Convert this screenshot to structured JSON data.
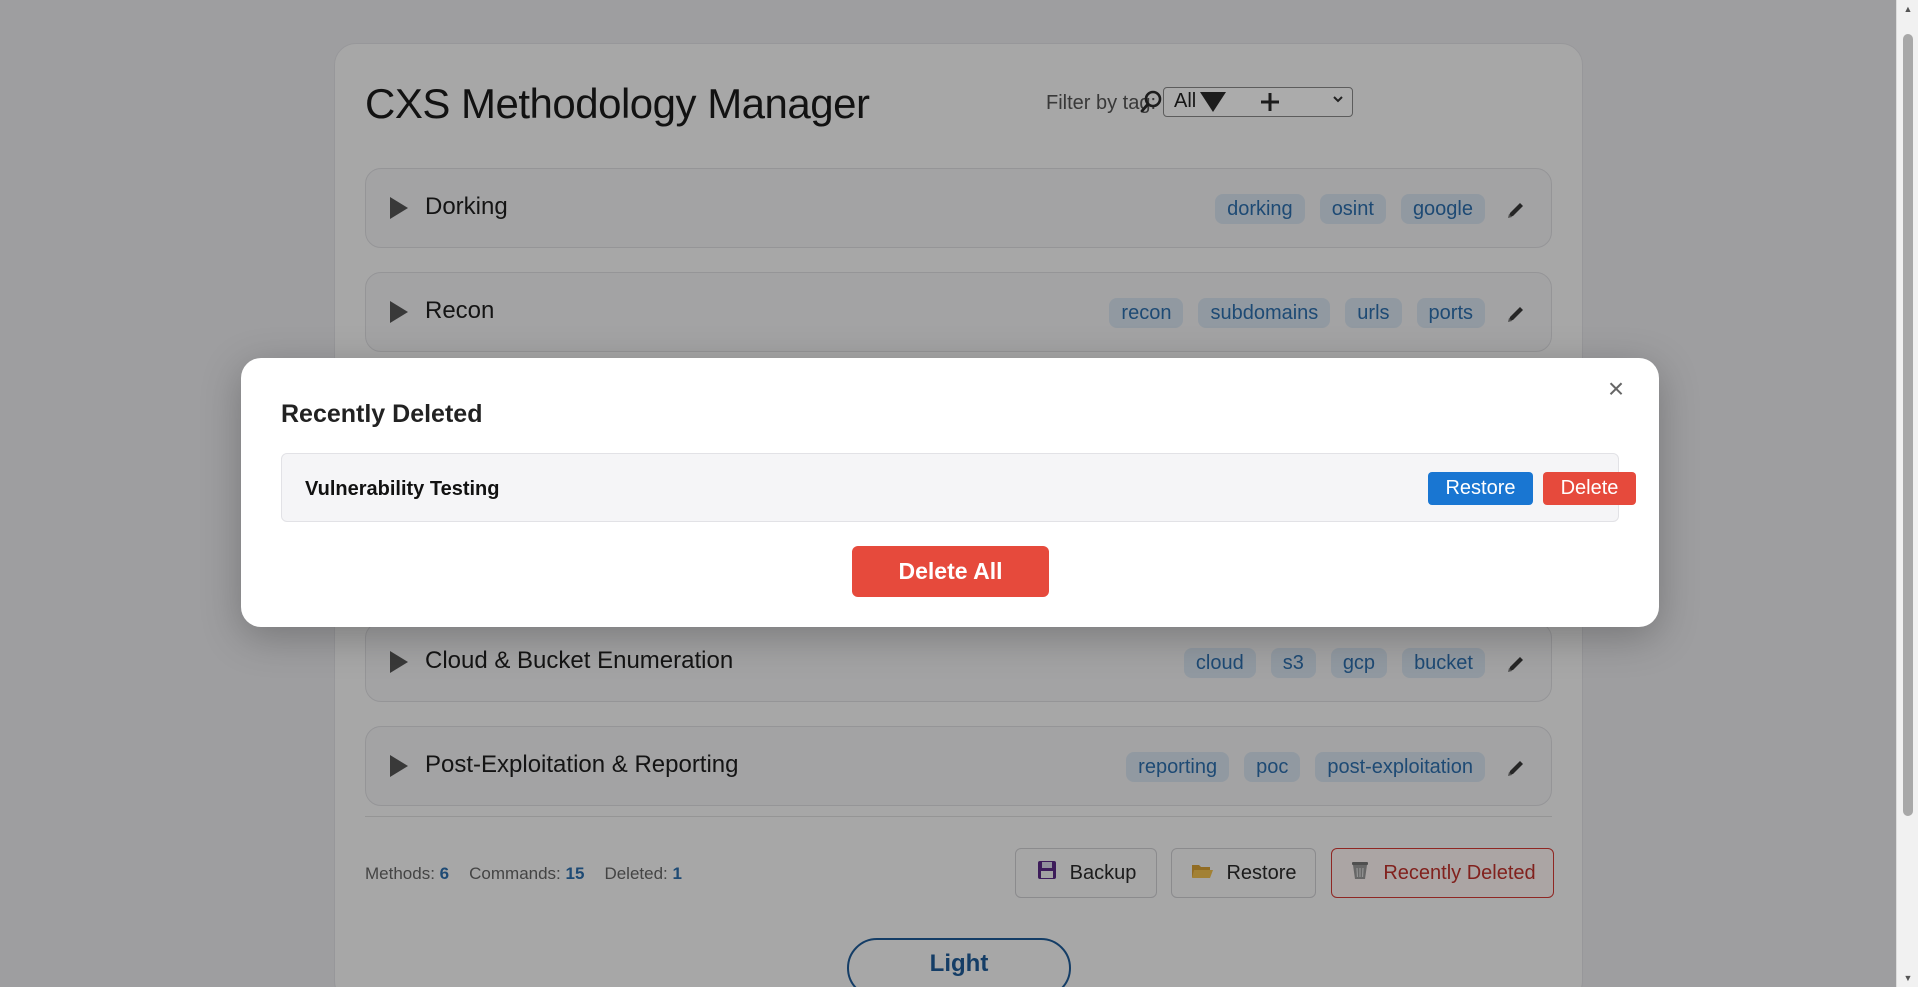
{
  "app": {
    "title": "CXS Methodology Manager",
    "filter_label": "Filter by tag:",
    "filter_value": "All"
  },
  "toolbar": {
    "search_icon": "search-icon",
    "filter_icon": "filter-icon",
    "add_icon": "plus-icon"
  },
  "methods": [
    {
      "name": "Dorking",
      "tags": [
        "dorking",
        "osint",
        "google"
      ]
    },
    {
      "name": "Recon",
      "tags": [
        "recon",
        "subdomains",
        "urls",
        "ports"
      ]
    },
    {
      "name": "Cloud & Bucket Enumeration",
      "tags": [
        "cloud",
        "s3",
        "gcp",
        "bucket"
      ]
    },
    {
      "name": "Post-Exploitation & Reporting",
      "tags": [
        "reporting",
        "poc",
        "post-exploitation"
      ]
    }
  ],
  "stats": {
    "methods_label": "Methods:",
    "methods_value": "6",
    "commands_label": "Commands:",
    "commands_value": "15",
    "deleted_label": "Deleted:",
    "deleted_value": "1"
  },
  "footer": {
    "backup_label": "Backup",
    "restore_label": "Restore",
    "recently_deleted_label": "Recently Deleted",
    "theme_label": "Light"
  },
  "modal": {
    "title": "Recently Deleted",
    "close_label": "×",
    "items": [
      {
        "name": "Vulnerability Testing",
        "restore_label": "Restore",
        "delete_label": "Delete"
      }
    ],
    "delete_all_label": "Delete All"
  },
  "colors": {
    "accent": "#1976d2",
    "danger": "#e64a3c",
    "tag_bg": "#d8e5f1",
    "tag_text": "#2d6fae"
  }
}
